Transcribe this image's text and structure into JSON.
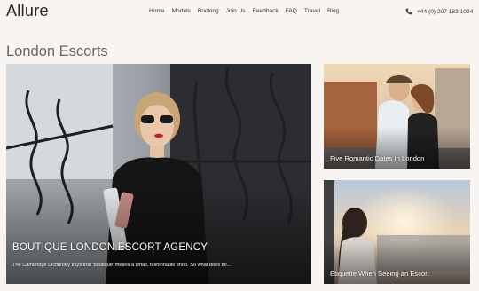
{
  "brand": {
    "name": "Allure"
  },
  "nav": {
    "items": [
      "Home",
      "Models",
      "Booking",
      "Join Us",
      "Feedback",
      "FAQ",
      "Travel",
      "Blog"
    ]
  },
  "contact": {
    "phone": "+44 (0) 207 183 1094"
  },
  "page": {
    "title": "London Escorts"
  },
  "featured": {
    "title": "BOUTIQUE LONDON ESCORT AGENCY",
    "excerpt": "The Cambridge Dictionary says that 'boutique' means a small, fashionable shop. So what does thi..."
  },
  "articles": [
    {
      "title": "Five Romantic Dates In London"
    },
    {
      "title": "Etiquette When Seeing an Escort"
    }
  ],
  "colors": {
    "background": "#f7f4f1",
    "text": "#333333"
  }
}
